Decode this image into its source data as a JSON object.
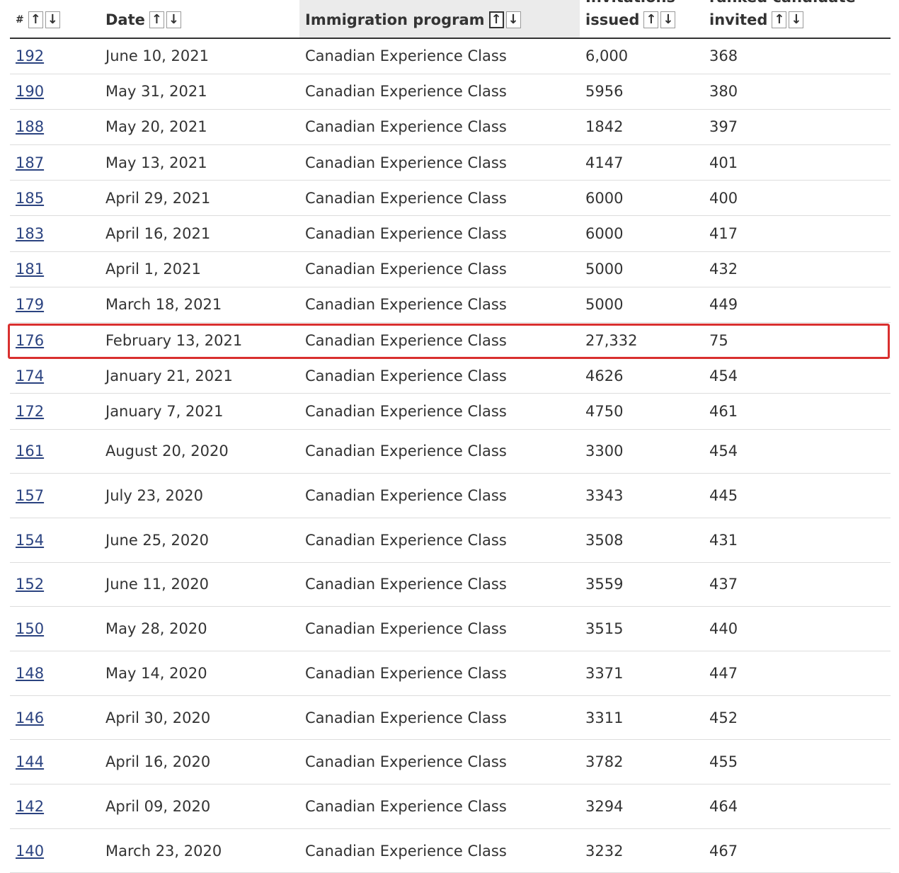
{
  "table": {
    "headers": {
      "num": {
        "label": "#"
      },
      "date": {
        "label": "Date"
      },
      "program": {
        "label": "Immigration program"
      },
      "invitations": {
        "top": "Invitations",
        "label": "issued"
      },
      "rank": {
        "top": "ranked candidate",
        "label": "invited"
      }
    },
    "sort_icons": {
      "up": "↑",
      "down": "↓"
    },
    "sorted_column": "program",
    "highlighted_row": "176",
    "highlight_color": "#d9302f",
    "link_color": "#2b4380",
    "rows": [
      {
        "num": "192",
        "date": "June 10, 2021",
        "program": "Canadian Experience Class",
        "invitations": "6,000",
        "rank": "368"
      },
      {
        "num": "190",
        "date": "May 31, 2021",
        "program": "Canadian Experience Class",
        "invitations": "5956",
        "rank": "380"
      },
      {
        "num": "188",
        "date": "May 20, 2021",
        "program": "Canadian Experience Class",
        "invitations": "1842",
        "rank": "397"
      },
      {
        "num": "187",
        "date": "May 13, 2021",
        "program": "Canadian Experience Class",
        "invitations": "4147",
        "rank": "401"
      },
      {
        "num": "185",
        "date": "April 29, 2021",
        "program": "Canadian Experience Class",
        "invitations": "6000",
        "rank": "400"
      },
      {
        "num": "183",
        "date": "April 16, 2021",
        "program": "Canadian Experience Class",
        "invitations": "6000",
        "rank": "417"
      },
      {
        "num": "181",
        "date": "April 1, 2021",
        "program": "Canadian Experience Class",
        "invitations": "5000",
        "rank": "432"
      },
      {
        "num": "179",
        "date": "March 18, 2021",
        "program": "Canadian Experience Class",
        "invitations": "5000",
        "rank": "449"
      },
      {
        "num": "176",
        "date": "February 13, 2021",
        "program": "Canadian Experience Class",
        "invitations": "27,332",
        "rank": "75"
      },
      {
        "num": "174",
        "date": "January 21, 2021",
        "program": "Canadian Experience Class",
        "invitations": "4626",
        "rank": "454"
      },
      {
        "num": "172",
        "date": "January 7, 2021",
        "program": "Canadian Experience Class",
        "invitations": "4750",
        "rank": "461"
      },
      {
        "num": "161",
        "date": "August 20, 2020",
        "program": "Canadian Experience Class",
        "invitations": "3300",
        "rank": "454"
      },
      {
        "num": "157",
        "date": "July 23, 2020",
        "program": "Canadian Experience Class",
        "invitations": "3343",
        "rank": "445"
      },
      {
        "num": "154",
        "date": "June 25, 2020",
        "program": "Canadian Experience Class",
        "invitations": "3508",
        "rank": "431"
      },
      {
        "num": "152",
        "date": "June 11, 2020",
        "program": "Canadian Experience Class",
        "invitations": "3559",
        "rank": "437"
      },
      {
        "num": "150",
        "date": "May 28, 2020",
        "program": "Canadian Experience Class",
        "invitations": "3515",
        "rank": "440"
      },
      {
        "num": "148",
        "date": "May 14, 2020",
        "program": "Canadian Experience Class",
        "invitations": "3371",
        "rank": "447"
      },
      {
        "num": "146",
        "date": "April 30, 2020",
        "program": "Canadian Experience Class",
        "invitations": "3311",
        "rank": "452"
      },
      {
        "num": "144",
        "date": "April 16, 2020",
        "program": "Canadian Experience Class",
        "invitations": "3782",
        "rank": "455"
      },
      {
        "num": "142",
        "date": "April 09, 2020",
        "program": "Canadian Experience Class",
        "invitations": "3294",
        "rank": "464"
      },
      {
        "num": "140",
        "date": "March 23, 2020",
        "program": "Canadian Experience Class",
        "invitations": "3232",
        "rank": "467"
      }
    ]
  }
}
